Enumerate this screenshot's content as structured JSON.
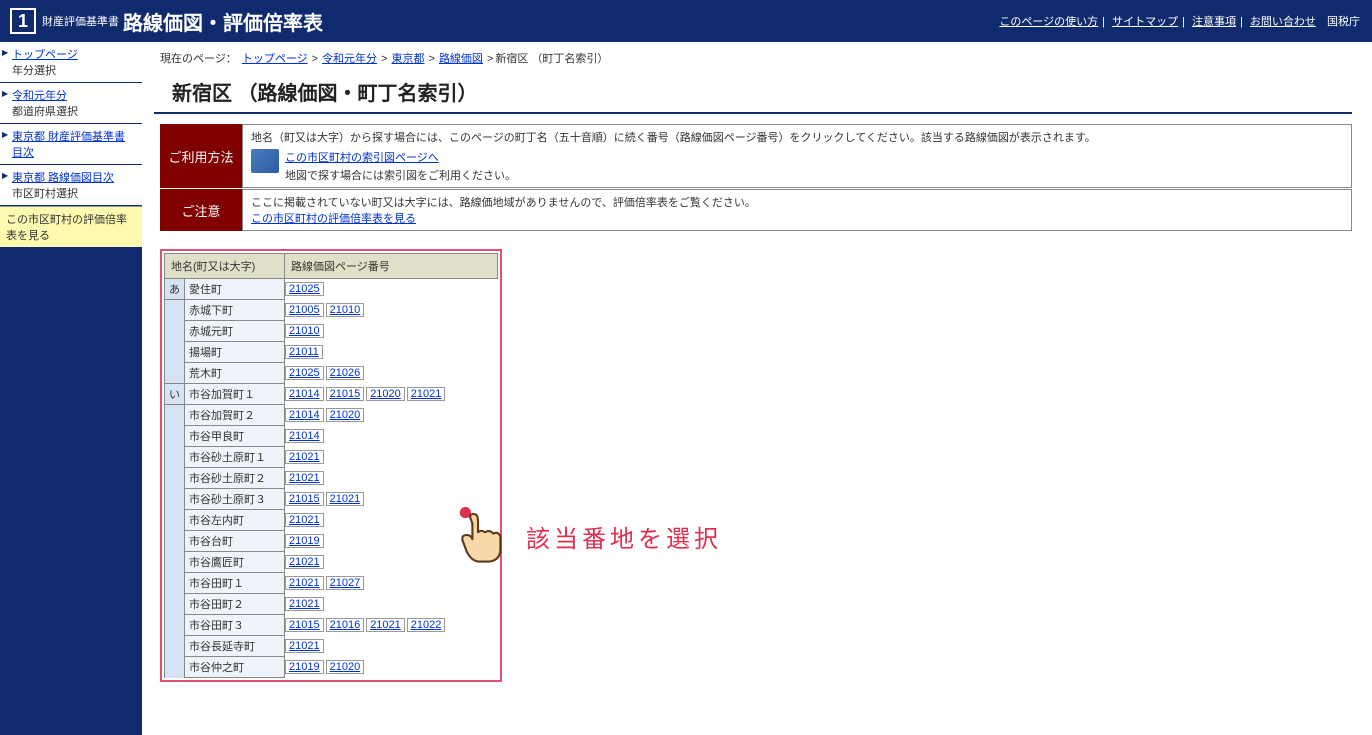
{
  "header": {
    "logo_num": "1",
    "small": "財産評価基準書",
    "title": "路線価図・評価倍率表",
    "links": {
      "usage": "このページの使い方",
      "sitemap": "サイトマップ",
      "notes": "注意事項",
      "contact": "お問い合わせ",
      "nta": "国税庁"
    }
  },
  "sidebar": {
    "items": [
      {
        "link": "トップページ",
        "sub": "年分選択"
      },
      {
        "link": "令和元年分",
        "sub": "都道府県選択"
      },
      {
        "link": "東京都 財産評価基準書目次",
        "sub": ""
      },
      {
        "link": "東京都 路線価図目次",
        "sub": "市区町村選択"
      }
    ],
    "yellow": "この市区町村の評価倍率表を見る"
  },
  "breadcrumb": {
    "prefix": "現在のページ：",
    "items": [
      {
        "text": "トップページ",
        "link": true
      },
      {
        "text": "令和元年分",
        "link": true
      },
      {
        "text": "東京都",
        "link": true
      },
      {
        "text": "路線価図",
        "link": true
      },
      {
        "text": "新宿区 （町丁名索引）",
        "link": false
      }
    ]
  },
  "page_title": "新宿区 （路線価図・町丁名索引）",
  "info": {
    "usage_label": "ご利用方法",
    "usage_text1": "地名（町又は大字）から探す場合には、このページの町丁名（五十音順）に続く番号（路線価図ページ番号）をクリックしてください。該当する路線価図が表示されます。",
    "usage_link": "この市区町村の索引図ページへ",
    "usage_text2": "地図で探す場合には索引図をご利用ください。",
    "note_label": "ご注意",
    "note_text": "ここに掲載されていない町又は大字には、路線価地域がありませんので、評価倍率表をご覧ください。",
    "note_link": "この市区町村の評価倍率表を見る"
  },
  "table": {
    "headers": {
      "name": "地名(町又は大字)",
      "pages": "路線価図ページ番号"
    },
    "rows": [
      {
        "kana": "あ",
        "name": "愛住町",
        "pages": [
          "21025"
        ]
      },
      {
        "kana": "",
        "name": "赤城下町",
        "pages": [
          "21005",
          "21010"
        ]
      },
      {
        "kana": "",
        "name": "赤城元町",
        "pages": [
          "21010"
        ]
      },
      {
        "kana": "",
        "name": "揚場町",
        "pages": [
          "21011"
        ]
      },
      {
        "kana": "",
        "name": "荒木町",
        "pages": [
          "21025",
          "21026"
        ]
      },
      {
        "kana": "い",
        "name": "市谷加賀町１",
        "pages": [
          "21014",
          "21015",
          "21020",
          "21021"
        ]
      },
      {
        "kana": "",
        "name": "市谷加賀町２",
        "pages": [
          "21014",
          "21020"
        ]
      },
      {
        "kana": "",
        "name": "市谷甲良町",
        "pages": [
          "21014"
        ]
      },
      {
        "kana": "",
        "name": "市谷砂土原町１",
        "pages": [
          "21021"
        ]
      },
      {
        "kana": "",
        "name": "市谷砂土原町２",
        "pages": [
          "21021"
        ]
      },
      {
        "kana": "",
        "name": "市谷砂土原町３",
        "pages": [
          "21015",
          "21021"
        ]
      },
      {
        "kana": "",
        "name": "市谷左内町",
        "pages": [
          "21021"
        ]
      },
      {
        "kana": "",
        "name": "市谷台町",
        "pages": [
          "21019"
        ]
      },
      {
        "kana": "",
        "name": "市谷鷹匠町",
        "pages": [
          "21021"
        ]
      },
      {
        "kana": "",
        "name": "市谷田町１",
        "pages": [
          "21021",
          "21027"
        ]
      },
      {
        "kana": "",
        "name": "市谷田町２",
        "pages": [
          "21021"
        ]
      },
      {
        "kana": "",
        "name": "市谷田町３",
        "pages": [
          "21015",
          "21016",
          "21021",
          "21022"
        ]
      },
      {
        "kana": "",
        "name": "市谷長延寺町",
        "pages": [
          "21021"
        ]
      },
      {
        "kana": "",
        "name": "市谷仲之町",
        "pages": [
          "21019",
          "21020"
        ]
      }
    ]
  },
  "overlay_text": "該当番地を選択"
}
